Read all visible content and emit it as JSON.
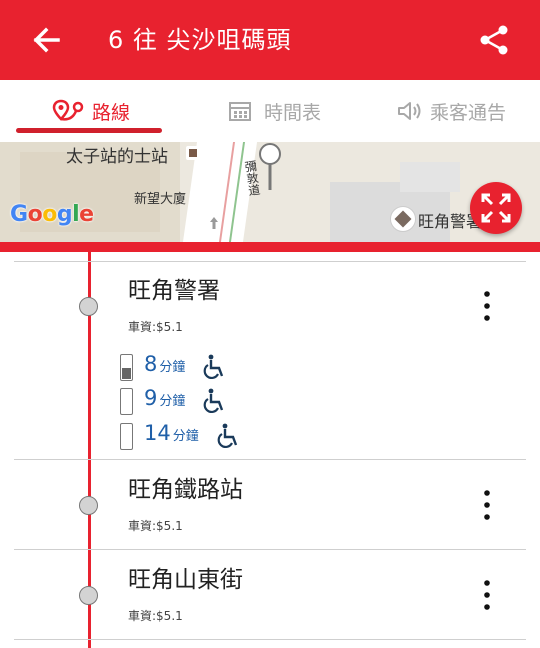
{
  "appbar": {
    "title": "6 往 尖沙咀碼頭",
    "back_icon": "arrow-left-icon",
    "share_icon": "share-icon"
  },
  "tabs": [
    {
      "label": "路線",
      "icon": "route-pin-icon",
      "active": true
    },
    {
      "label": "時間表",
      "icon": "calendar-icon",
      "active": false
    },
    {
      "label": "乘客通告",
      "icon": "speaker-icon",
      "active": false
    }
  ],
  "map": {
    "labels": {
      "taxi_stand": "太子站的士站",
      "building": "新望大廈",
      "street": "彌敦道",
      "police": "旺角警署"
    },
    "logo": "Google",
    "expand_icon": "fullscreen-icon"
  },
  "stops": [
    {
      "name": "旺角警署",
      "fare": "車資:$5.1",
      "etas": [
        {
          "minutes": "8",
          "unit": "分鐘",
          "wheelchair": true,
          "load_fraction": 0.45
        },
        {
          "minutes": "9",
          "unit": "分鐘",
          "wheelchair": true,
          "load_fraction": 0
        },
        {
          "minutes": "14",
          "unit": "分鐘",
          "wheelchair": true,
          "load_fraction": 0
        }
      ]
    },
    {
      "name": "旺角鐵路站",
      "fare": "車資:$5.1"
    },
    {
      "name": "旺角山東街",
      "fare": "車資:$5.1"
    }
  ],
  "colors": {
    "primary": "#e8222f",
    "eta_text": "#1f5fa8",
    "tab_inactive": "#a8a8a8"
  }
}
